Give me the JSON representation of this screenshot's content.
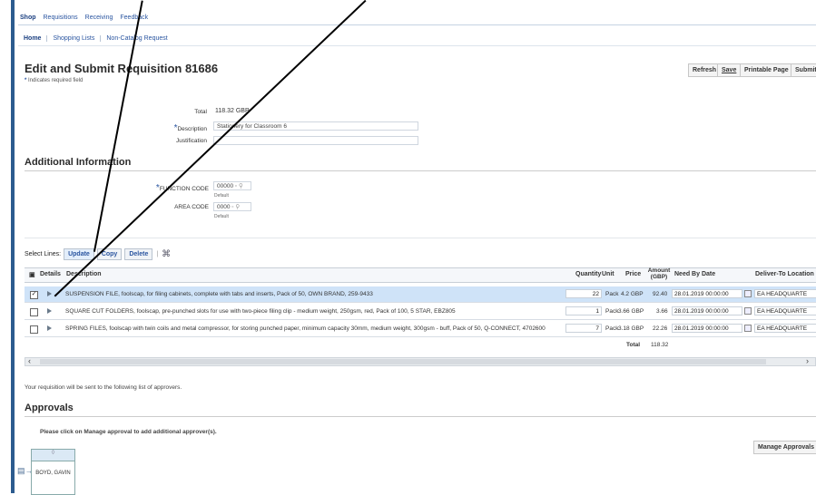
{
  "tabs": [
    "Shop",
    "Requisitions",
    "Receiving",
    "Feedback"
  ],
  "subtabs": [
    "Home",
    "Shopping Lists",
    "Non-Catalog Request"
  ],
  "page_title": "Edit and Submit Requisition 81686",
  "actions": {
    "refresh": "Refresh",
    "save": "Save",
    "printable": "Printable Page",
    "submit": "Submit"
  },
  "required_note": "Indicates required field",
  "summary": {
    "total_label": "Total",
    "total_value": "118.32 GBP",
    "description_label": "Description",
    "description_value": "Stationery for Classroom 6",
    "justification_label": "Justification",
    "justification_value": ""
  },
  "additional": {
    "heading": "Additional Information",
    "function_label": "FUNCTION CODE",
    "function_value": "00000",
    "function_hint": "Default",
    "area_label": "AREA CODE",
    "area_value": "0000",
    "area_hint": "Default"
  },
  "toolbar": {
    "select_label": "Select Lines:",
    "update": "Update",
    "copy": "Copy",
    "delete": "Delete"
  },
  "columns": {
    "details": "Details",
    "description": "Description",
    "quantity": "Quantity",
    "unit": "Unit",
    "price": "Price",
    "amount": "Amount (GBP)",
    "need_by": "Need By Date",
    "deliver_to": "Deliver-To Location"
  },
  "lines": [
    {
      "checked": true,
      "description": "SUSPENSION FILE, foolscap, for filing cabinets, complete with tabs and inserts, Pack of 50, OWN BRAND, 259-9433",
      "quantity": "22",
      "unit": "Pack",
      "price": "4.2 GBP",
      "amount": "92.40",
      "need_by": "28.01.2019 00:00:00",
      "deliver_to": "EA HEADQUARTE"
    },
    {
      "checked": false,
      "description": "SQUARE CUT FOLDERS, foolscap, pre-punched slots for use with two-piece filing clip - medium weight, 250gsm, red, Pack of 100, 5 STAR, EBZ805",
      "quantity": "1",
      "unit": "Pack",
      "price": "3.66 GBP",
      "amount": "3.66",
      "need_by": "28.01.2019 00:00:00",
      "deliver_to": "EA HEADQUARTE"
    },
    {
      "checked": false,
      "description": "SPRING FILES, foolscap with twin coils and metal compressor, for storing punched paper, minimum capacity 30mm, medium weight, 300gsm - buff, Pack of 50, Q-CONNECT, 4702600",
      "quantity": "7",
      "unit": "Pack",
      "price": "3.18 GBP",
      "amount": "22.26",
      "need_by": "28.01.2019 00:00:00",
      "deliver_to": "EA HEADQUARTE"
    }
  ],
  "table_total": {
    "label": "Total",
    "value": "118.32"
  },
  "approvals": {
    "intro": "Your requisition will be sent to the following list of approvers.",
    "heading": "Approvals",
    "instruction": "Please click on Manage approval to add additional approver(s).",
    "manage_button": "Manage Approvals",
    "approver_name": "BOYD, GAVIN"
  }
}
